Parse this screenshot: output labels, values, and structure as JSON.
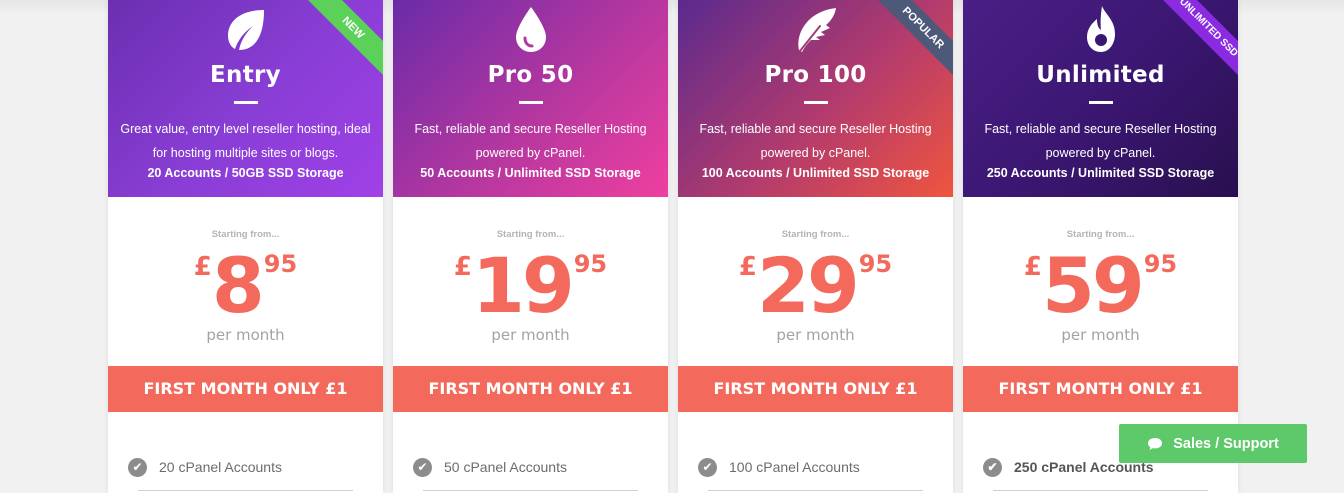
{
  "plans": [
    {
      "name": "Entry",
      "desc": "Great value, entry level reseller hosting, ideal for hosting multiple sites or blogs.",
      "spec": "20 Accounts / 50GB SSD Storage",
      "ribbon": "NEW",
      "starting": "Starting from...",
      "currency": "£",
      "price": "8",
      "cents": "95",
      "per": "per month",
      "offer": "FIRST MONTH ONLY £1",
      "feature": "20 cPanel Accounts",
      "icon": "leaf-icon"
    },
    {
      "name": "Pro 50",
      "desc": "Fast, reliable and secure Reseller Hosting powered by cPanel.",
      "spec": "50 Accounts / Unlimited SSD Storage",
      "ribbon": "",
      "starting": "Starting from...",
      "currency": "£",
      "price": "19",
      "cents": "95",
      "per": "per month",
      "offer": "FIRST MONTH ONLY £1",
      "feature": "50 cPanel Accounts",
      "icon": "drop-icon"
    },
    {
      "name": "Pro 100",
      "desc": "Fast, reliable and secure Reseller Hosting powered by cPanel.",
      "spec": "100 Accounts / Unlimited SSD Storage",
      "ribbon": "POPULAR",
      "starting": "Starting from...",
      "currency": "£",
      "price": "29",
      "cents": "95",
      "per": "per month",
      "offer": "FIRST MONTH ONLY £1",
      "feature": "100 cPanel Accounts",
      "icon": "feather-icon"
    },
    {
      "name": "Unlimited",
      "desc": "Fast, reliable and secure Reseller Hosting powered by cPanel.",
      "spec": "250 Accounts / Unlimited SSD Storage",
      "ribbon": "UNLIMITED SSD",
      "starting": "Starting from...",
      "currency": "£",
      "price": "59",
      "cents": "95",
      "per": "per month",
      "offer": "FIRST MONTH ONLY £1",
      "feature": "250 cPanel Accounts",
      "icon": "flame-icon"
    }
  ],
  "support": {
    "label": "Sales / Support"
  },
  "colors": {
    "accent": "#f36a5d",
    "support": "#5dc96a",
    "new_ribbon": "#5bd15a",
    "popular_ribbon": "#4e5878",
    "unlimited_ribbon": "#8a2be2"
  }
}
